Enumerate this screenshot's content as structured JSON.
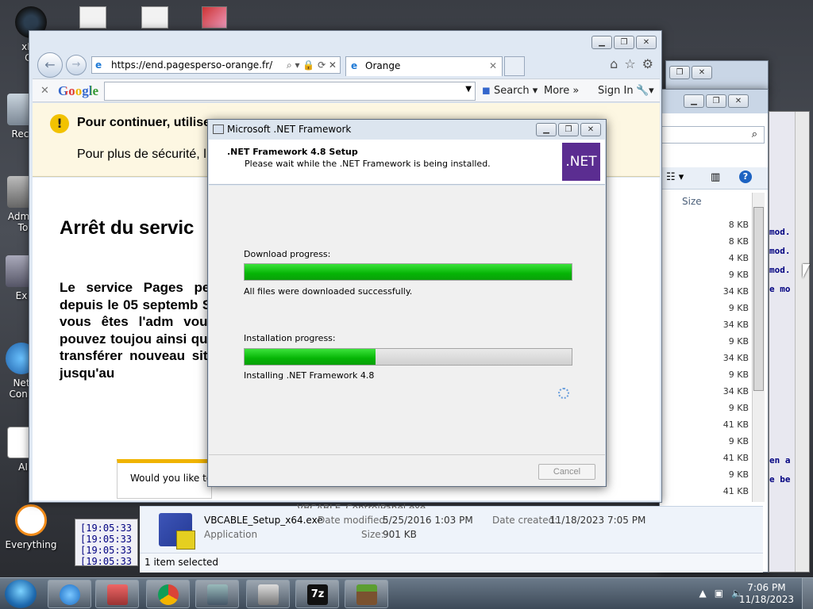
{
  "desktop": {
    "icons": [
      {
        "label": "xDa\nCe"
      },
      {
        "label": "Recy"
      },
      {
        "label": "Admin\nTo"
      },
      {
        "label": "Ex"
      },
      {
        "label": "Net\nConn"
      },
      {
        "label": "AI"
      },
      {
        "label": "Everything"
      }
    ]
  },
  "ie": {
    "address": "https://end.pagesperso-orange.fr/",
    "tab_title": "Orange",
    "google_logo": "Google",
    "google_search_btn": "Search",
    "google_more": "More »",
    "google_signin": "Sign In",
    "info_title": "Pour continuer, utilise",
    "info_sub": "Pour plus de sécurité, l",
    "heading": "Arrêt du servic",
    "paragraph": "Le service Pages per depuis le 05 septemb Si vous êtes l'adm vous pouvez toujou ainsi que transférer nouveau site jusqu'au",
    "notification": "Would you like to m"
  },
  "dialog": {
    "title": "Microsoft .NET Framework",
    "header_title": ".NET Framework 4.8 Setup",
    "header_sub": "Please wait while the .NET Framework is being installed.",
    "logo": ".NET",
    "download_label": "Download progress:",
    "download_progress": 1.0,
    "download_status": "All files were downloaded successfully.",
    "install_label": "Installation progress:",
    "install_progress": 0.4,
    "install_status": "Installing .NET Framework 4.8",
    "cancel": "Cancel"
  },
  "explorer": {
    "size_header": "Size",
    "sizes": [
      "8 KB",
      "8 KB",
      "4 KB",
      "9 KB",
      "34 KB",
      "9 KB",
      "34 KB",
      "9 KB",
      "34 KB",
      "9 KB",
      "34 KB",
      "9 KB",
      "41 KB",
      "9 KB",
      "41 KB",
      "9 KB",
      "41 KB"
    ],
    "partial_row": "VBCABLE_ControlPanel.exe",
    "details": {
      "filename": "VBCABLE_Setup_x64.exe",
      "type": "Application",
      "modified_label": "Date modified:",
      "modified": "5/25/2016 1:03 PM",
      "created_label": "Date created:",
      "created": "11/18/2023 7:05 PM",
      "size_label": "Size:",
      "size": "901 KB"
    },
    "status": "1 item selected"
  },
  "console_left": [
    "[19:05:33",
    "[19:05:33",
    "[19:05:33",
    "[19:05:33"
  ],
  "console_right": [
    "mod.",
    "mod.",
    "mod.",
    "e mo",
    "en a",
    "e be"
  ],
  "taskbar": {
    "time": "7:06 PM",
    "date": "11/18/2023"
  }
}
